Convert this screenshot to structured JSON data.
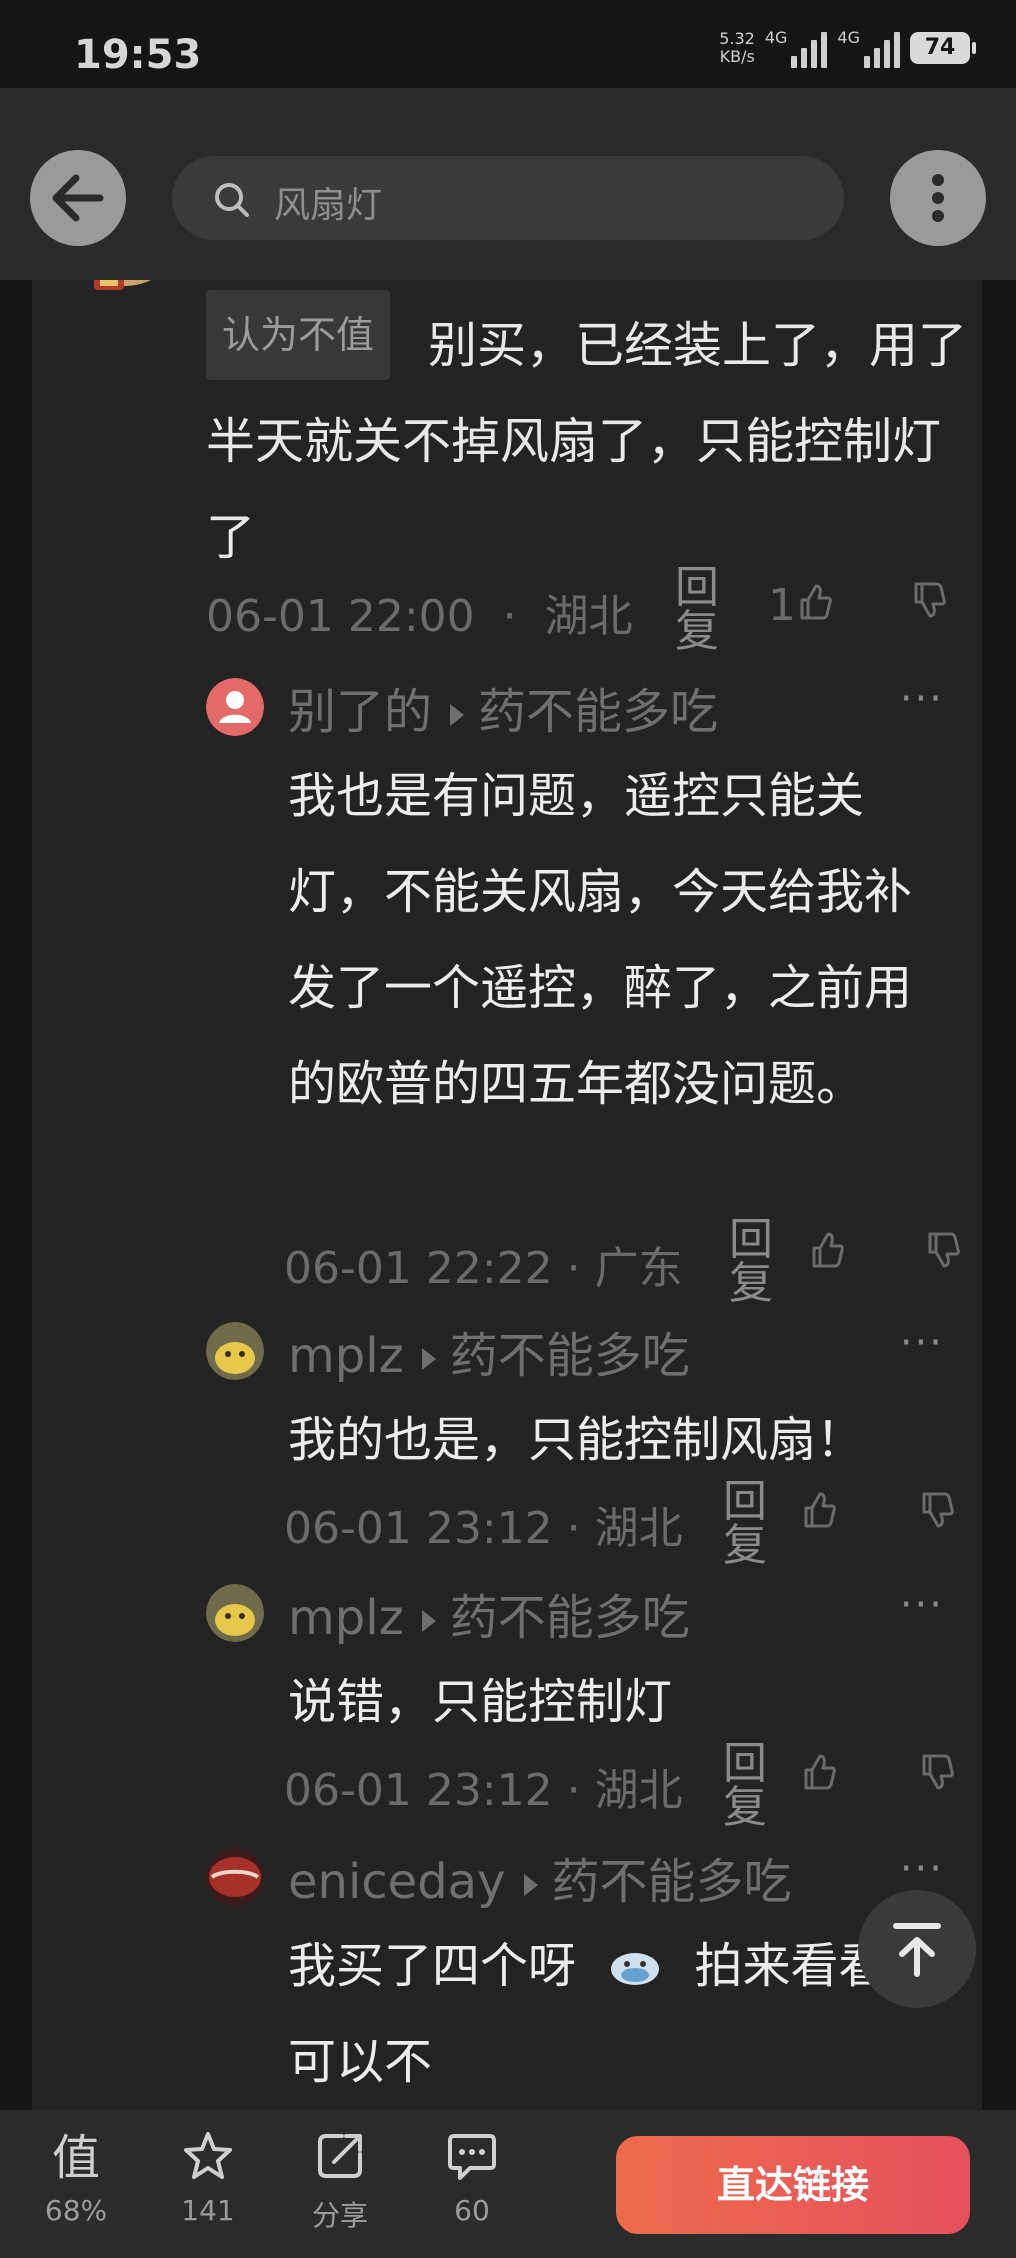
{
  "status_bar": {
    "time": "19:53",
    "net_speed_value": "5.32",
    "net_speed_unit": "KB/s",
    "network_1": "4G",
    "network_2": "4G",
    "battery": "74"
  },
  "header": {
    "search_text": "风扇灯"
  },
  "main_comment": {
    "tag": "认为不值",
    "text": "别买，已经装上了，用了半天就关不掉风扇了，只能控制灯了",
    "time": "06-01 22:00",
    "location": "湖北",
    "reply_label": "回复",
    "likes": "1"
  },
  "replies": [
    {
      "user": "别了的",
      "target": "药不能多吃",
      "text": "我也是有问题，遥控只能关灯，不能关风扇，今天给我补发了一个遥控，醉了，之前用的欧普的四五年都没问题。",
      "time": "06-01 22:22",
      "location": "广东",
      "reply_label": "回复"
    },
    {
      "user": "mplz",
      "target": "药不能多吃",
      "text": "我的也是，只能控制风扇！",
      "time": "06-01 23:12",
      "location": "湖北",
      "reply_label": "回复"
    },
    {
      "user": "mplz",
      "target": "药不能多吃",
      "text": "说错，只能控制灯",
      "time": "06-01 23:12",
      "location": "湖北",
      "reply_label": "回复"
    },
    {
      "user": "eniceday",
      "target": "药不能多吃",
      "text_before_emoji": "我买了四个呀",
      "text_after_emoji": "拍来看看可以不"
    }
  ],
  "separator": "·",
  "more_label": "···",
  "bottom_bar": {
    "worth_label": "68%",
    "favorite_label": "141",
    "share_label": "分享",
    "comment_label": "60",
    "cta_label": "直达链接"
  },
  "icons": {
    "back": "arrow-left-icon",
    "search": "search-icon",
    "more": "more-vertical-icon",
    "like": "thumb-up-icon",
    "dislike": "thumb-down-icon",
    "scroll_top": "arrow-up-to-top-icon",
    "worth": "worth-icon",
    "favorite": "star-icon",
    "share": "share-icon",
    "comment": "chat-bubble-icon"
  },
  "colors": {
    "background": "#232323",
    "cta_start": "#ee6b4d",
    "cta_end": "#e5515d"
  }
}
